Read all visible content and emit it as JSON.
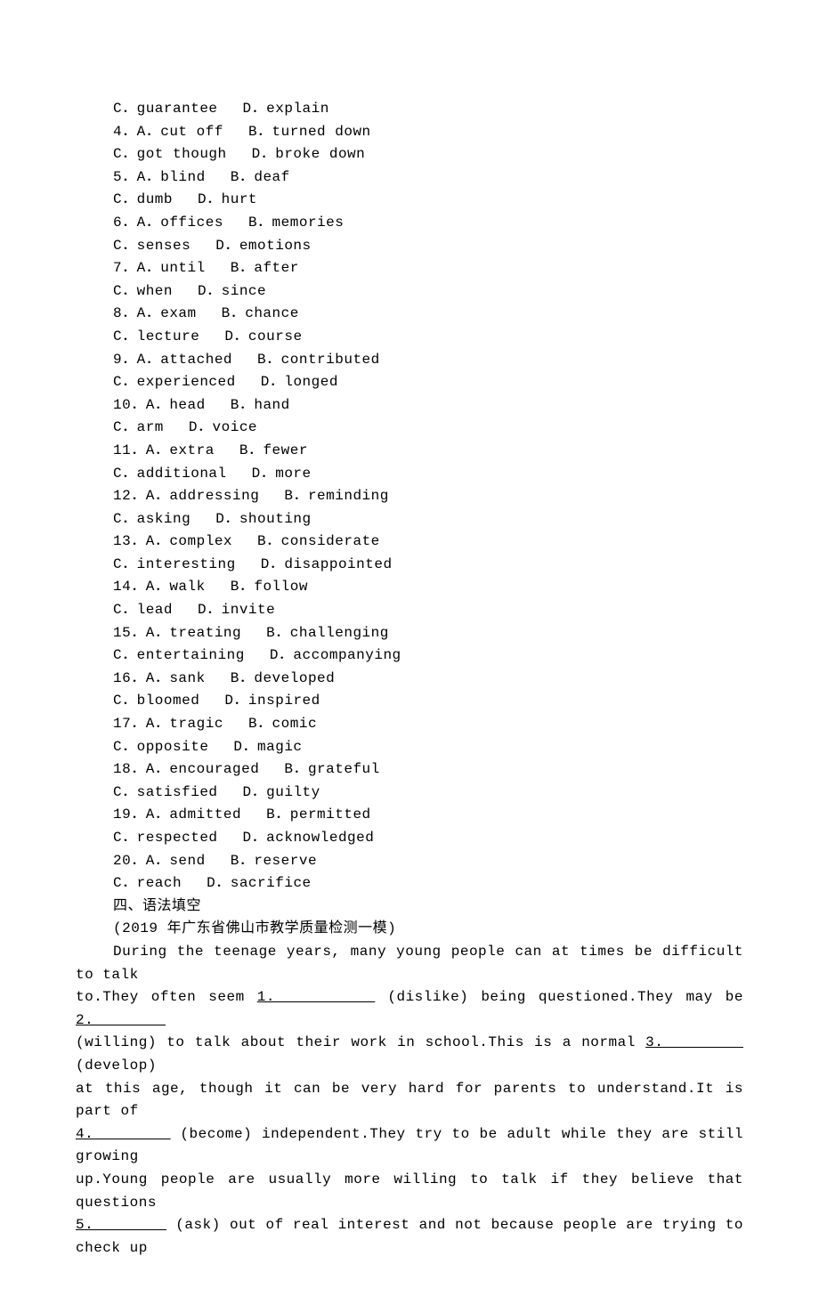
{
  "questions": [
    {
      "num": "",
      "options": [
        {
          "letter": "C",
          "text": "guarantee"
        },
        {
          "letter": "D",
          "text": "explain"
        }
      ]
    },
    {
      "num": "4．",
      "options": [
        {
          "letter": "A",
          "text": "cut off"
        },
        {
          "letter": "B",
          "text": "turned down"
        }
      ]
    },
    {
      "num": "",
      "options": [
        {
          "letter": "C",
          "text": "got though"
        },
        {
          "letter": "D",
          "text": "broke down"
        }
      ]
    },
    {
      "num": "5．",
      "options": [
        {
          "letter": "A",
          "text": "blind"
        },
        {
          "letter": "B",
          "text": "deaf"
        }
      ]
    },
    {
      "num": "",
      "options": [
        {
          "letter": "C",
          "text": "dumb"
        },
        {
          "letter": "D",
          "text": "hurt"
        }
      ]
    },
    {
      "num": "6．",
      "options": [
        {
          "letter": "A",
          "text": "offices"
        },
        {
          "letter": "B",
          "text": "memories"
        }
      ]
    },
    {
      "num": "",
      "options": [
        {
          "letter": "C",
          "text": "senses"
        },
        {
          "letter": "D",
          "text": "emotions"
        }
      ]
    },
    {
      "num": "7．",
      "options": [
        {
          "letter": "A",
          "text": "until"
        },
        {
          "letter": "B",
          "text": "after"
        }
      ]
    },
    {
      "num": "",
      "options": [
        {
          "letter": "C",
          "text": "when"
        },
        {
          "letter": "D",
          "text": "since"
        }
      ]
    },
    {
      "num": "8．",
      "options": [
        {
          "letter": "A",
          "text": "exam"
        },
        {
          "letter": "B",
          "text": "chance"
        }
      ]
    },
    {
      "num": "",
      "options": [
        {
          "letter": "C",
          "text": "lecture"
        },
        {
          "letter": "D",
          "text": "course"
        }
      ]
    },
    {
      "num": "9．",
      "options": [
        {
          "letter": "A",
          "text": "attached"
        },
        {
          "letter": "B",
          "text": "contributed"
        }
      ]
    },
    {
      "num": "",
      "options": [
        {
          "letter": "C",
          "text": "experienced"
        },
        {
          "letter": "D",
          "text": "longed"
        }
      ]
    },
    {
      "num": "10．",
      "options": [
        {
          "letter": "A",
          "text": "head"
        },
        {
          "letter": "B",
          "text": "hand"
        }
      ]
    },
    {
      "num": "",
      "options": [
        {
          "letter": "C",
          "text": "arm"
        },
        {
          "letter": "D",
          "text": "voice"
        }
      ]
    },
    {
      "num": "11．",
      "options": [
        {
          "letter": "A",
          "text": "extra"
        },
        {
          "letter": "B",
          "text": "fewer"
        }
      ]
    },
    {
      "num": "",
      "options": [
        {
          "letter": "C",
          "text": "additional"
        },
        {
          "letter": "D",
          "text": "more"
        }
      ]
    },
    {
      "num": "12．",
      "options": [
        {
          "letter": "A",
          "text": "addressing"
        },
        {
          "letter": "B",
          "text": "reminding"
        }
      ]
    },
    {
      "num": "",
      "options": [
        {
          "letter": "C",
          "text": "asking"
        },
        {
          "letter": "D",
          "text": "shouting"
        }
      ]
    },
    {
      "num": "13．",
      "options": [
        {
          "letter": "A",
          "text": "complex"
        },
        {
          "letter": "B",
          "text": "considerate"
        }
      ]
    },
    {
      "num": "",
      "options": [
        {
          "letter": "C",
          "text": "interesting"
        },
        {
          "letter": "D",
          "text": "disappointed"
        }
      ]
    },
    {
      "num": "14．",
      "options": [
        {
          "letter": "A",
          "text": "walk"
        },
        {
          "letter": "B",
          "text": "follow"
        }
      ]
    },
    {
      "num": "",
      "options": [
        {
          "letter": "C",
          "text": "lead"
        },
        {
          "letter": "D",
          "text": "invite"
        }
      ]
    },
    {
      "num": "15．",
      "options": [
        {
          "letter": "A",
          "text": "treating"
        },
        {
          "letter": "B",
          "text": "challenging"
        }
      ]
    },
    {
      "num": "",
      "options": [
        {
          "letter": "C",
          "text": "entertaining"
        },
        {
          "letter": "D",
          "text": "accompanying"
        }
      ]
    },
    {
      "num": "16．",
      "options": [
        {
          "letter": "A",
          "text": "sank"
        },
        {
          "letter": "B",
          "text": "developed"
        }
      ]
    },
    {
      "num": "",
      "options": [
        {
          "letter": "C",
          "text": "bloomed"
        },
        {
          "letter": "D",
          "text": "inspired"
        }
      ]
    },
    {
      "num": "17．",
      "options": [
        {
          "letter": "A",
          "text": "tragic"
        },
        {
          "letter": "B",
          "text": "comic"
        }
      ]
    },
    {
      "num": "",
      "options": [
        {
          "letter": "C",
          "text": "opposite"
        },
        {
          "letter": "D",
          "text": "magic"
        }
      ]
    },
    {
      "num": "18．",
      "options": [
        {
          "letter": "A",
          "text": "encouraged"
        },
        {
          "letter": "B",
          "text": "grateful"
        }
      ]
    },
    {
      "num": "",
      "options": [
        {
          "letter": "C",
          "text": "satisfied"
        },
        {
          "letter": "D",
          "text": "guilty"
        }
      ]
    },
    {
      "num": "19．",
      "options": [
        {
          "letter": "A",
          "text": "admitted"
        },
        {
          "letter": "B",
          "text": "permitted"
        }
      ]
    },
    {
      "num": "",
      "options": [
        {
          "letter": "C",
          "text": "respected"
        },
        {
          "letter": "D",
          "text": "acknowledged"
        }
      ]
    },
    {
      "num": "20．",
      "options": [
        {
          "letter": "A",
          "text": "send"
        },
        {
          "letter": "B",
          "text": "reserve"
        }
      ]
    },
    {
      "num": "",
      "options": [
        {
          "letter": "C",
          "text": "reach"
        },
        {
          "letter": "D",
          "text": "sacrifice"
        }
      ]
    }
  ],
  "section_title": "四、语法填空",
  "source": "(2019 年广东省佛山市教学质量检测一模)",
  "passage": {
    "l1a": "During the teenage years, many young people can at times be difficult to talk",
    "l2a": "to.They often seem ",
    "blank1": "1.        ",
    "l2b": " (dislike) being questioned.They may be ",
    "blank2": "2.        ",
    "l3a": "(willing) to talk about their work in school.This is a normal ",
    "blank3": "3.        ",
    "l3b": " (develop)",
    "l4a": "at this age, though it can be very hard for parents to understand.It is part of",
    "blank4": "4.        ",
    "l5b": " (become) independent.They try to be adult while they are still growing",
    "l6a": "up.Young people are usually more willing to talk if they believe that questions",
    "blank5": "5.        ",
    "l7b": " (ask) out of real interest and not because people are trying to check up"
  }
}
